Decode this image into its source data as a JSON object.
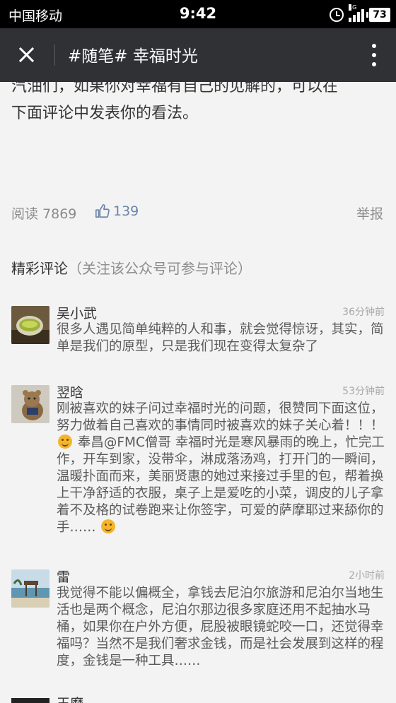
{
  "status_bar": {
    "carrier": "中国移动",
    "time": "9:42",
    "network": "4G",
    "battery": "73"
  },
  "app_bar": {
    "title": "#随笔# 幸福时光"
  },
  "article": {
    "tail_lines": [
      "汽油们，如果你对幸福有自己的见解的，可以在",
      "下面评论中发表你的看法。"
    ],
    "read_label": "阅读 7869",
    "likes": "139",
    "report": "举报"
  },
  "comments_section": {
    "heading": "精彩评论",
    "note": "（关注该公众号可参与评论）"
  },
  "comments": [
    {
      "name": "吴小武",
      "time": "36分钟前",
      "text": "很多人遇见简单纯粹的人和事，就会觉得惊讶，其实，简单是我们的原型，只是我们现在变得太复杂了"
    },
    {
      "name": "翌晗",
      "time": "53分钟前",
      "text_part1": "刚被喜欢的妹子问过幸福时光的问题，很赞同下面这位，努力做着自己喜欢的事情同时被喜欢的妹子关心着！！！",
      "text_part2": "奉昌@FMC僧哥 幸福时光是寒风暴雨的晚上，忙完工作，开车到家，没带伞，淋成落汤鸡，打开门的一瞬间，温暖扑面而来，美丽贤惠的她过来接过手里的包，帮着换上干净舒适的衣服，桌子上是爱吃的小菜，调皮的儿子拿着不及格的试卷跑来让你签字，可爱的萨摩耶过来舔你的手……"
    },
    {
      "name": "雷",
      "time": "2小时前",
      "text": "我觉得不能以偏概全，拿钱去尼泊尔旅游和尼泊尔当地生活也是两个概念，尼泊尔那边很多家庭还用不起抽水马桶，如果你在户外方便，屁股被眼镜蛇咬一口，还觉得幸福吗？当然不是我们奢求金钱，而是社会发展到这样的程度，金钱是一种工具……"
    }
  ],
  "next_comment": {
    "name": "王磨"
  }
}
